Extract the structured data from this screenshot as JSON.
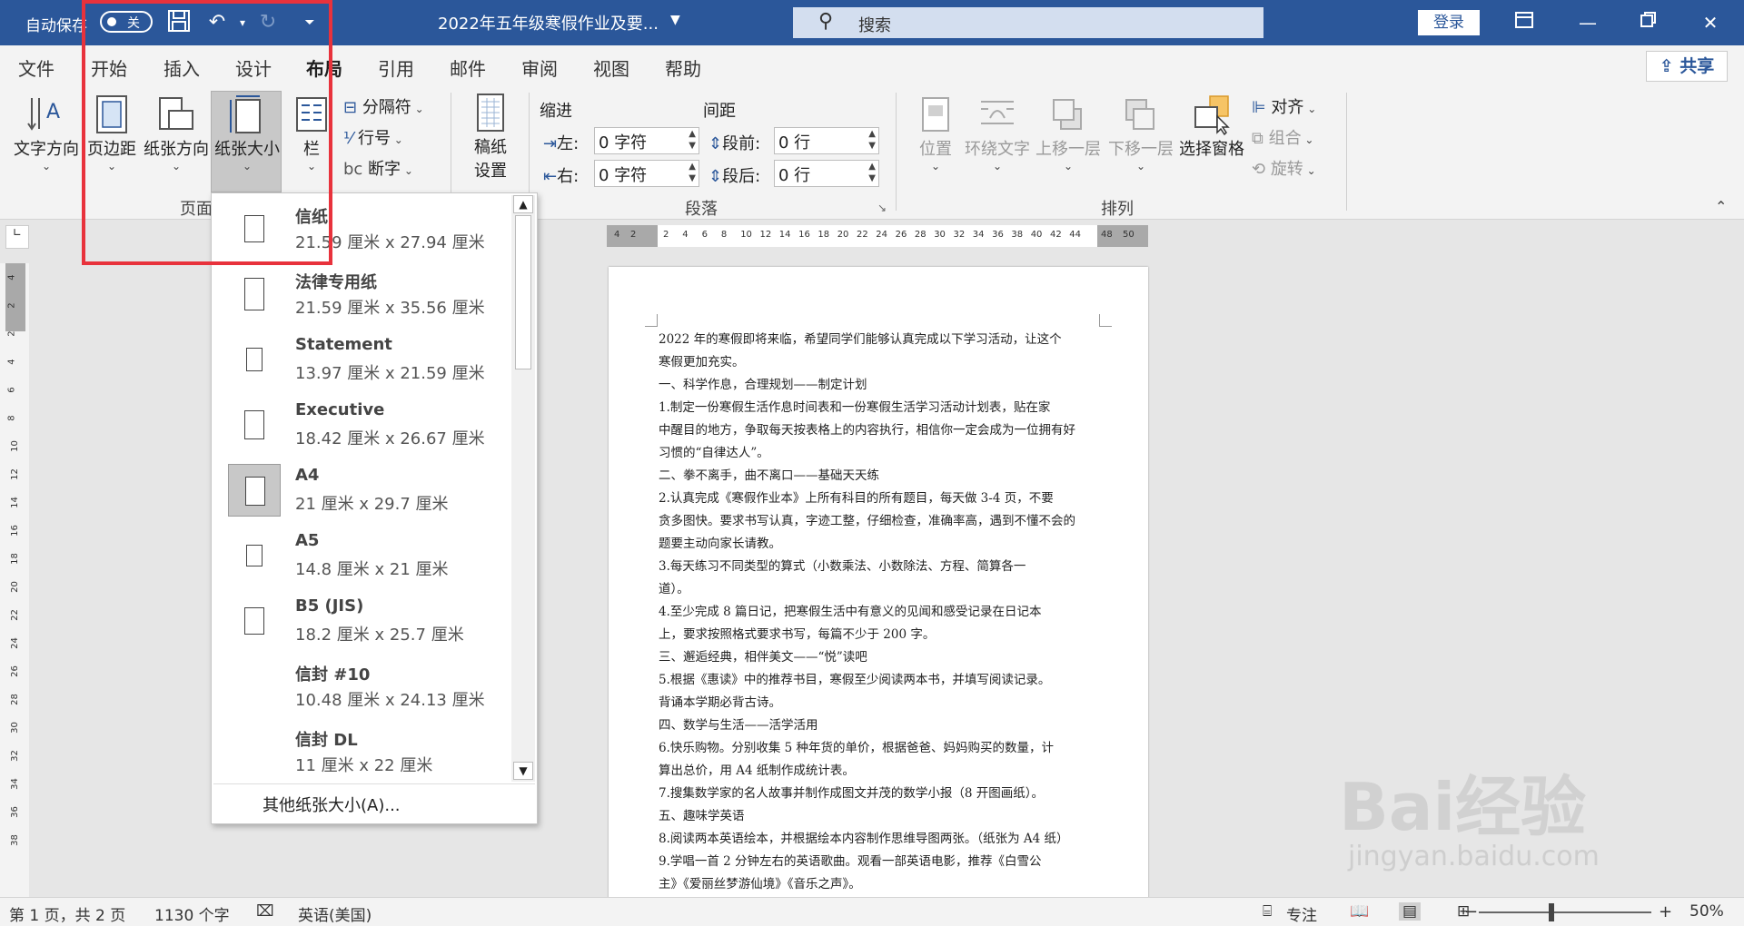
{
  "titlebar": {
    "autosave_label": "自动保存",
    "autosave_state": "关",
    "doc_title": "2022年五年级寒假作业及要...",
    "search_placeholder": "搜索",
    "login": "登录"
  },
  "tabs": [
    "文件",
    "开始",
    "插入",
    "设计",
    "布局",
    "引用",
    "邮件",
    "审阅",
    "视图",
    "帮助"
  ],
  "share": "共享",
  "ribbon": {
    "page_setup": {
      "text_direction": "文字方向",
      "margins": "页边距",
      "orientation": "纸张方向",
      "size": "纸张大小",
      "columns": "栏",
      "breaks": "分隔符",
      "line_numbers": "行号",
      "hyphenation": "断字",
      "group_label": "页面"
    },
    "draft": {
      "label1": "稿纸",
      "label2": "设置"
    },
    "paragraph": {
      "indent_title": "缩进",
      "spacing_title": "间距",
      "left_label": "左:",
      "left_value": "0 字符",
      "right_label": "右:",
      "right_value": "0 字符",
      "before_label": "段前:",
      "before_value": "0 行",
      "after_label": "段后:",
      "after_value": "0 行",
      "group_label": "段落"
    },
    "arrange": {
      "position": "位置",
      "wrap_text": "环绕文字",
      "bring_forward": "上移一层",
      "send_backward": "下移一层",
      "selection_pane": "选择窗格",
      "align": "对齐",
      "group": "组合",
      "rotate": "旋转",
      "group_label": "排列"
    }
  },
  "paper_sizes": [
    {
      "name": "信纸",
      "dims": "21.59 厘米 x 27.94 厘米",
      "selected": false
    },
    {
      "name": "法律专用纸",
      "dims": "21.59 厘米 x 35.56 厘米",
      "selected": false
    },
    {
      "name": "Statement",
      "dims": "13.97 厘米 x 21.59 厘米",
      "selected": false
    },
    {
      "name": "Executive",
      "dims": "18.42 厘米 x 26.67 厘米",
      "selected": false
    },
    {
      "name": "A4",
      "dims": "21 厘米 x 29.7 厘米",
      "selected": true
    },
    {
      "name": "A5",
      "dims": "14.8 厘米 x 21 厘米",
      "selected": false
    },
    {
      "name": "B5 (JIS)",
      "dims": "18.2 厘米 x 25.7 厘米",
      "selected": false
    },
    {
      "name": "信封 #10",
      "dims": "10.48 厘米 x 24.13 厘米",
      "selected": false
    },
    {
      "name": "信封 DL",
      "dims": "11 厘米 x 22 厘米",
      "selected": false
    }
  ],
  "more_sizes": "其他纸张大小(A)...",
  "ruler": {
    "horizontal": [
      "4",
      "2",
      "2",
      "4",
      "6",
      "8",
      "10",
      "12",
      "14",
      "16",
      "18",
      "20",
      "22",
      "24",
      "26",
      "28",
      "30",
      "32",
      "34",
      "36",
      "38",
      "40",
      "42",
      "44",
      "48",
      "50"
    ],
    "vertical": [
      "4",
      "2",
      "2",
      "4",
      "6",
      "8",
      "10",
      "12",
      "14",
      "16",
      "18",
      "20",
      "22",
      "24",
      "26",
      "28",
      "30",
      "32",
      "34",
      "36",
      "38"
    ]
  },
  "document_lines": [
    "2022 年的寒假即将来临，希望同学们能够认真完成以下学习活动，让这个",
    "寒假更加充实。",
    "    一、科学作息，合理规划——制定计划",
    "    1.制定一份寒假生活作息时间表和一份寒假生活学习活动计划表，贴在家",
    "中醒目的地方，争取每天按表格上的内容执行，相信你一定会成为一位拥有好",
    "习惯的“自律达人”。",
    "    二、拳不离手，曲不离口——基础天天练",
    "    2.认真完成《寒假作业本》上所有科目的所有题目，每天做 3-4 页，不要",
    "贪多图快。要求书写认真，字迹工整，仔细检查，准确率高，遇到不懂不会的",
    "题要主动向家长请教。",
    "    3.每天练习不同类型的算式（小数乘法、小数除法、方程、简算各一",
    "道）。",
    "    4.至少完成 8 篇日记，把寒假生活中有意义的见闻和感受记录在日记本",
    "上，要求按照格式要求书写，每篇不少于 200 字。",
    "    三、邂逅经典，相伴美文——“悦”读吧",
    "    5.根据《惠读》中的推荐书目，寒假至少阅读两本书，并填写阅读记录。",
    "  背诵本学期必背古诗。",
    "    四、数学与生活——活学活用",
    "    6.快乐购物。分别收集 5 种年货的单价，根据爸爸、妈妈购买的数量，计",
    "算出总价，用 A4 纸制作成统计表。",
    "    7.搜集数学家的名人故事并制作成图文并茂的数学小报（8 开图画纸）。",
    "    五、趣味学英语",
    "    8.阅读两本英语绘本，并根据绘本内容制作思维导图两张。（纸张为 A4 纸）",
    "    9.学唱一首 2 分钟左右的英语歌曲。观看一部英语电影，推荐《白雪公",
    "主》《爱丽丝梦游仙境》《音乐之声》。"
  ],
  "statusbar": {
    "page": "第 1 页，共 2 页",
    "words": "1130 个字",
    "language": "英语(美国)",
    "focus": "专注",
    "zoom": "50%"
  },
  "watermark": {
    "line1": "Bai经验",
    "line2": "jingyan.baidu.com"
  },
  "colors": {
    "accent": "#2b579a",
    "highlight": "#e8323c"
  }
}
